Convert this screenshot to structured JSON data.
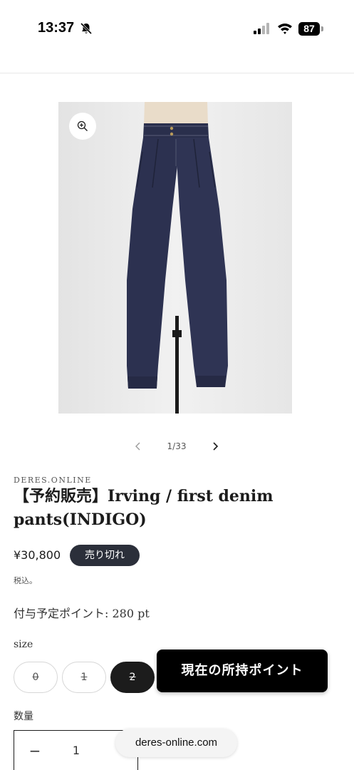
{
  "status_bar": {
    "time": "13:37",
    "battery": "87",
    "icons": [
      "bell-slash-icon",
      "cellular-signal-icon",
      "wifi-icon",
      "battery-icon"
    ]
  },
  "gallery": {
    "zoom_icon": "zoom-in-icon",
    "counter": "1/33",
    "prev_icon": "chevron-left-icon",
    "next_icon": "chevron-right-icon"
  },
  "product": {
    "vendor": "DERES.ONLINE",
    "title": "【予約販売】Irving / first denim pants(INDIGO)",
    "price": "¥30,800",
    "badge": "売り切れ",
    "tax_note": "税込。",
    "points": "付与予定ポイント: 280 pt"
  },
  "size": {
    "label": "size",
    "options": [
      {
        "label": "0",
        "selected": false,
        "sold_out": true
      },
      {
        "label": "1",
        "selected": false,
        "sold_out": true
      },
      {
        "label": "2",
        "selected": true,
        "sold_out": true
      }
    ]
  },
  "points_popup": {
    "label": "現在の所持ポイント"
  },
  "quantity": {
    "label": "数量",
    "minus": "−",
    "value": "1"
  },
  "browser": {
    "url": "deres-online.com"
  },
  "colors": {
    "badge_bg": "#2b2f3a",
    "denim": "#2c3150",
    "selected_option": "#1c1c1c"
  }
}
